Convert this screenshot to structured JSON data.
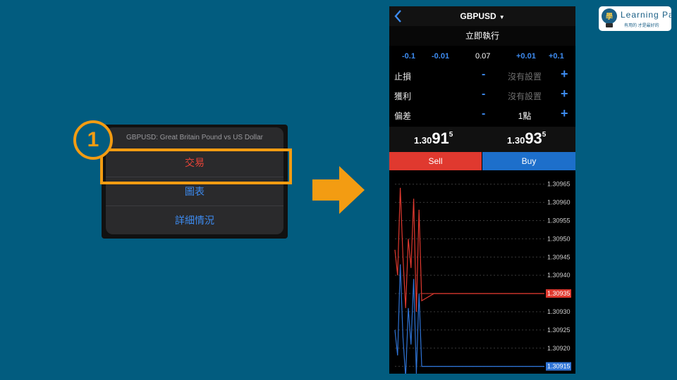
{
  "left_menu": {
    "header": "GBPUSD: Great Britain Pound vs US Dollar",
    "items": [
      {
        "label": "交易"
      },
      {
        "label": "圖表"
      },
      {
        "label": "詳細情況"
      }
    ],
    "step_number": "1"
  },
  "logo": {
    "text": "Learning Pa",
    "subtitle": "有用的 才是最好的",
    "icon": "lightbulb-icon"
  },
  "trade_screen": {
    "symbol": "GBPUSD",
    "execution": "立即執行",
    "volume": {
      "minus_large": "-0.1",
      "minus_small": "-0.01",
      "value": "0.07",
      "plus_small": "+0.01",
      "plus_large": "+0.1"
    },
    "settings": [
      {
        "label": "止損",
        "minus": "-",
        "value": "沒有設置",
        "plus": "+"
      },
      {
        "label": "獲利",
        "minus": "-",
        "value": "沒有設置",
        "plus": "+"
      },
      {
        "label": "偏差",
        "minus": "-",
        "value": "1點",
        "plus": "+"
      }
    ],
    "sell_price": {
      "small": "1.30",
      "big": "91",
      "tick": "5"
    },
    "buy_price": {
      "small": "1.30",
      "big": "93",
      "tick": "5"
    },
    "sell_label": "Sell",
    "buy_label": "Buy",
    "colors": {
      "sell": "#e0392f",
      "buy": "#1d6fcb",
      "accent": "#3d8bf0",
      "highlight": "#f39c12"
    }
  },
  "chart_data": {
    "type": "line",
    "y_ticks": [
      "1.30965",
      "1.30960",
      "1.30955",
      "1.30950",
      "1.30945",
      "1.30940",
      "1.30935",
      "1.30930",
      "1.30925",
      "1.30920",
      "1.30915"
    ],
    "ylim": [
      1.30913,
      1.30969
    ],
    "grid": true,
    "markers": [
      {
        "name": "bid",
        "value": 1.30915,
        "label": "1.30915",
        "color": "#2f74d6"
      },
      {
        "name": "ask",
        "value": 1.30935,
        "label": "1.30935",
        "color": "#e0392f"
      }
    ],
    "series": [
      {
        "color": "#e0392f",
        "values": [
          1.30947,
          1.3094,
          1.30964,
          1.30945,
          1.30931,
          1.3095,
          1.30942,
          1.30961,
          1.3093,
          1.30958,
          1.30933,
          1.30935,
          1.30935,
          1.30935,
          1.30935,
          1.30935,
          1.30935,
          1.30935,
          1.30935,
          1.30935,
          1.30935
        ]
      },
      {
        "color": "#2f74d6",
        "values": [
          1.30925,
          1.30918,
          1.30943,
          1.30923,
          1.30912,
          1.30931,
          1.30921,
          1.30939,
          1.30913,
          1.30935,
          1.30915,
          1.30915,
          1.30915,
          1.30915,
          1.30915,
          1.30915,
          1.30915,
          1.30915,
          1.30915,
          1.30915,
          1.30915
        ]
      }
    ]
  }
}
